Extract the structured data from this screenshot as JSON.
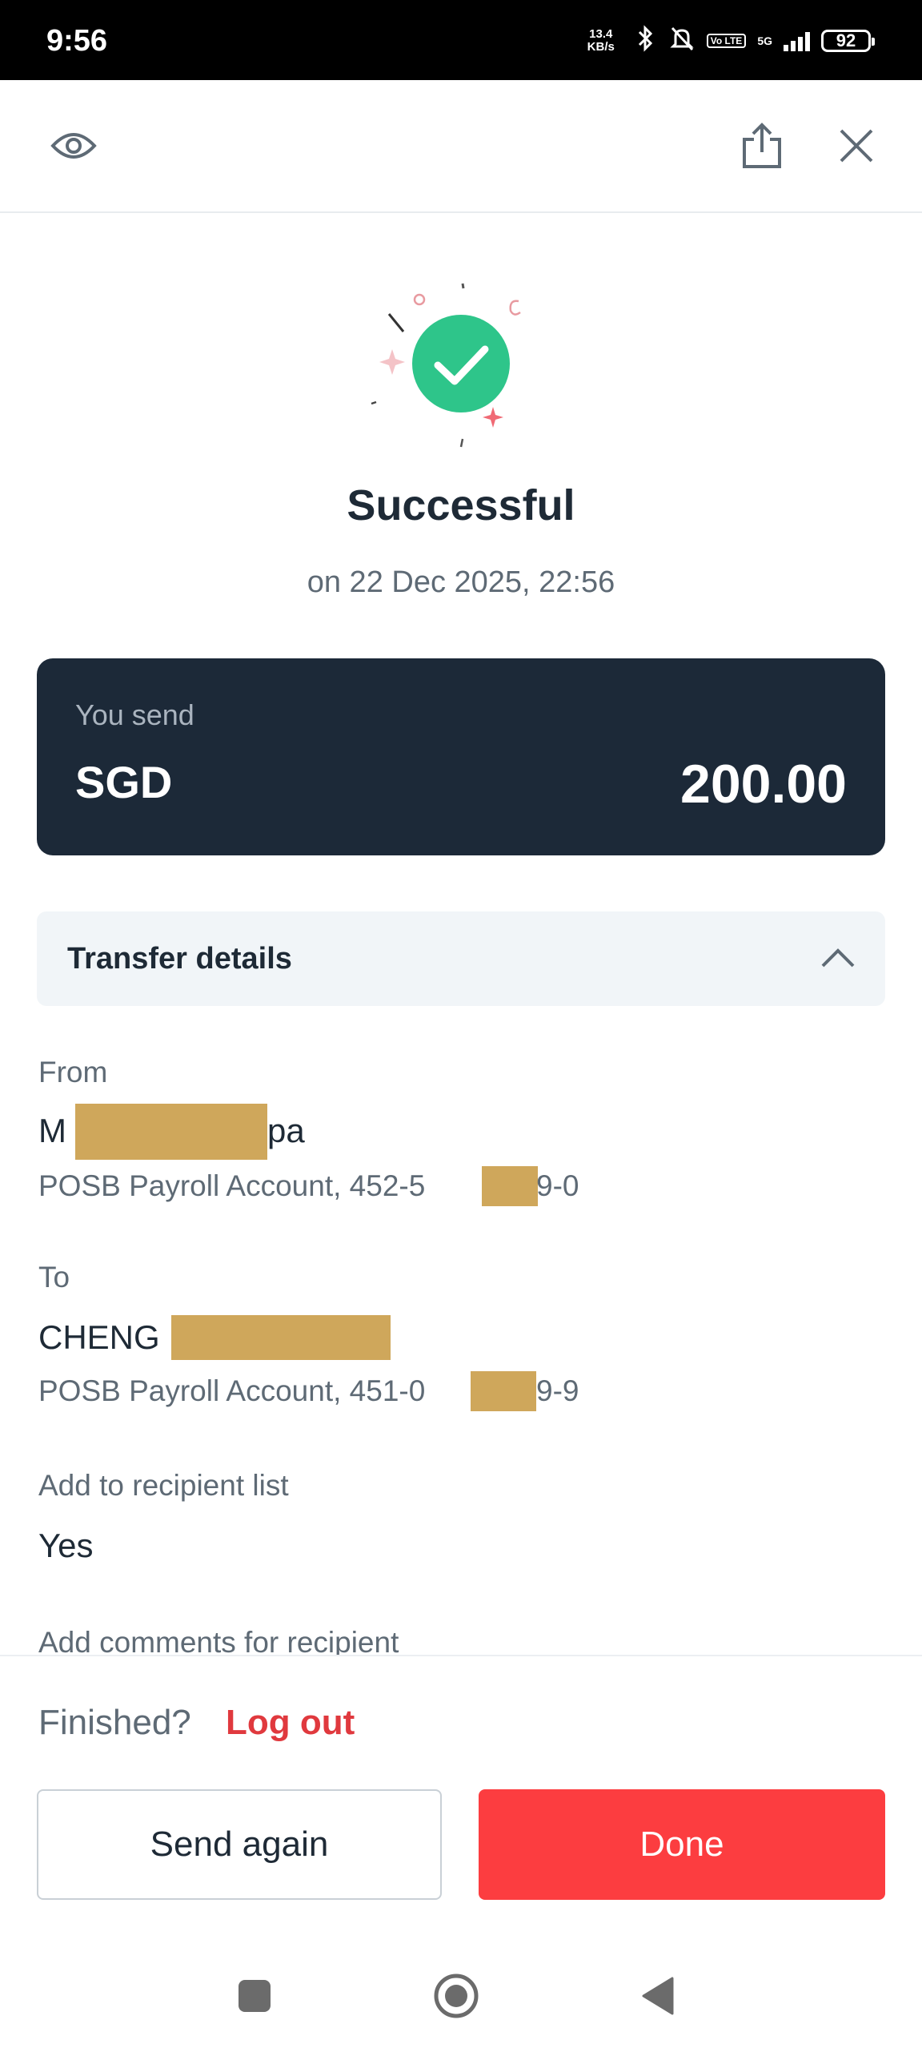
{
  "status_bar": {
    "time": "9:56",
    "net_speed_value": "13.4",
    "net_speed_unit": "KB/s",
    "volte": "Vo LTE",
    "network": "5G",
    "battery": "92"
  },
  "header": {
    "eye_icon": "eye-icon",
    "share_icon": "share-icon",
    "close_icon": "close-icon"
  },
  "result": {
    "title": "Successful",
    "timestamp": "on 22 Dec 2025, 22:56",
    "accent_color": "#2ec58a"
  },
  "send_card": {
    "label": "You send",
    "currency": "SGD",
    "amount": "200.00"
  },
  "details": {
    "section_title": "Transfer details",
    "from_label": "From",
    "from_name_start": "M",
    "from_name_end": "pa",
    "from_account_start": "POSB Payroll Account, 452-5",
    "from_account_end": "9-0",
    "to_label": "To",
    "to_name_start": "CHENG",
    "to_account_start": "POSB Payroll Account, 451-0",
    "to_account_end": "9-9",
    "recipient_list_label": "Add to recipient list",
    "recipient_list_value": "Yes",
    "comments_label": "Add comments for recipient"
  },
  "footer": {
    "finished_text": "Finished?",
    "logout_label": "Log out",
    "send_again_label": "Send again",
    "done_label": "Done"
  }
}
